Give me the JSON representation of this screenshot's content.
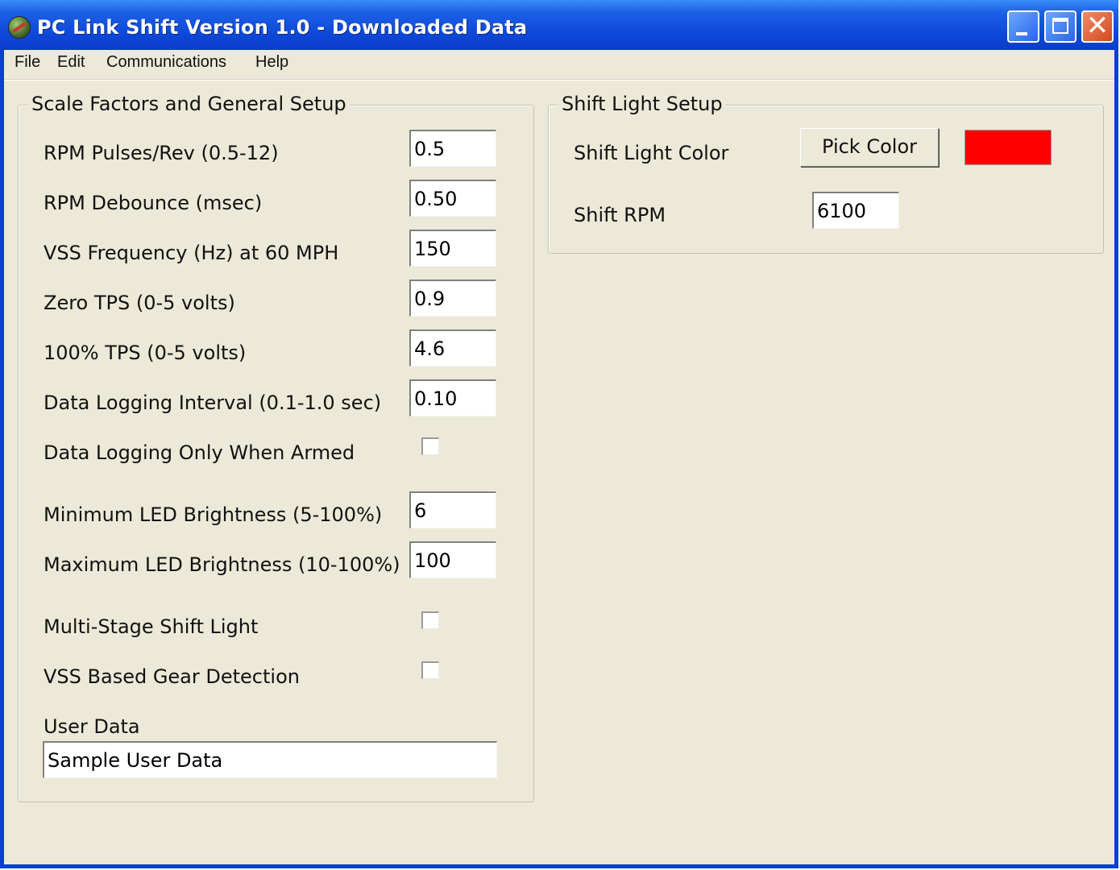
{
  "window": {
    "title": "PC Link Shift Version 1.0 - Downloaded Data",
    "close_glyph": "✕"
  },
  "menu": {
    "items": [
      "File",
      "Edit",
      "Communications",
      "Help"
    ]
  },
  "scale_group": {
    "legend": "Scale Factors and General Setup",
    "rpm_pulses": {
      "label": "RPM Pulses/Rev (0.5-12)",
      "value": "0.5"
    },
    "rpm_debounce": {
      "label": "RPM Debounce (msec)",
      "value": "0.50"
    },
    "vss_freq": {
      "label": "VSS Frequency (Hz)  at 60 MPH",
      "value": "150"
    },
    "zero_tps": {
      "label": "Zero TPS (0-5 volts)",
      "value": "0.9"
    },
    "full_tps": {
      "label": "100% TPS (0-5 volts)",
      "value": "4.6"
    },
    "log_interval": {
      "label": "Data Logging Interval (0.1-1.0 sec)",
      "value": "0.10"
    },
    "log_armed": {
      "label": "Data Logging Only When Armed",
      "checked": false
    },
    "min_led": {
      "label": "Minimum LED Brightness (5-100%)",
      "value": "6"
    },
    "max_led": {
      "label": "Maximum LED Brightness (10-100%)",
      "value": "100"
    },
    "multi_stage": {
      "label": "Multi-Stage Shift Light",
      "checked": false
    },
    "vss_gear": {
      "label": "VSS Based Gear Detection",
      "checked": false
    },
    "user_data": {
      "label": "User Data",
      "value": "Sample User Data"
    }
  },
  "shift_group": {
    "legend": "Shift Light Setup",
    "color_label": "Shift Light Color",
    "pick_button": "Pick Color",
    "swatch_color": "#ff0000",
    "rpm_label": "Shift RPM",
    "rpm_value": "6100"
  }
}
